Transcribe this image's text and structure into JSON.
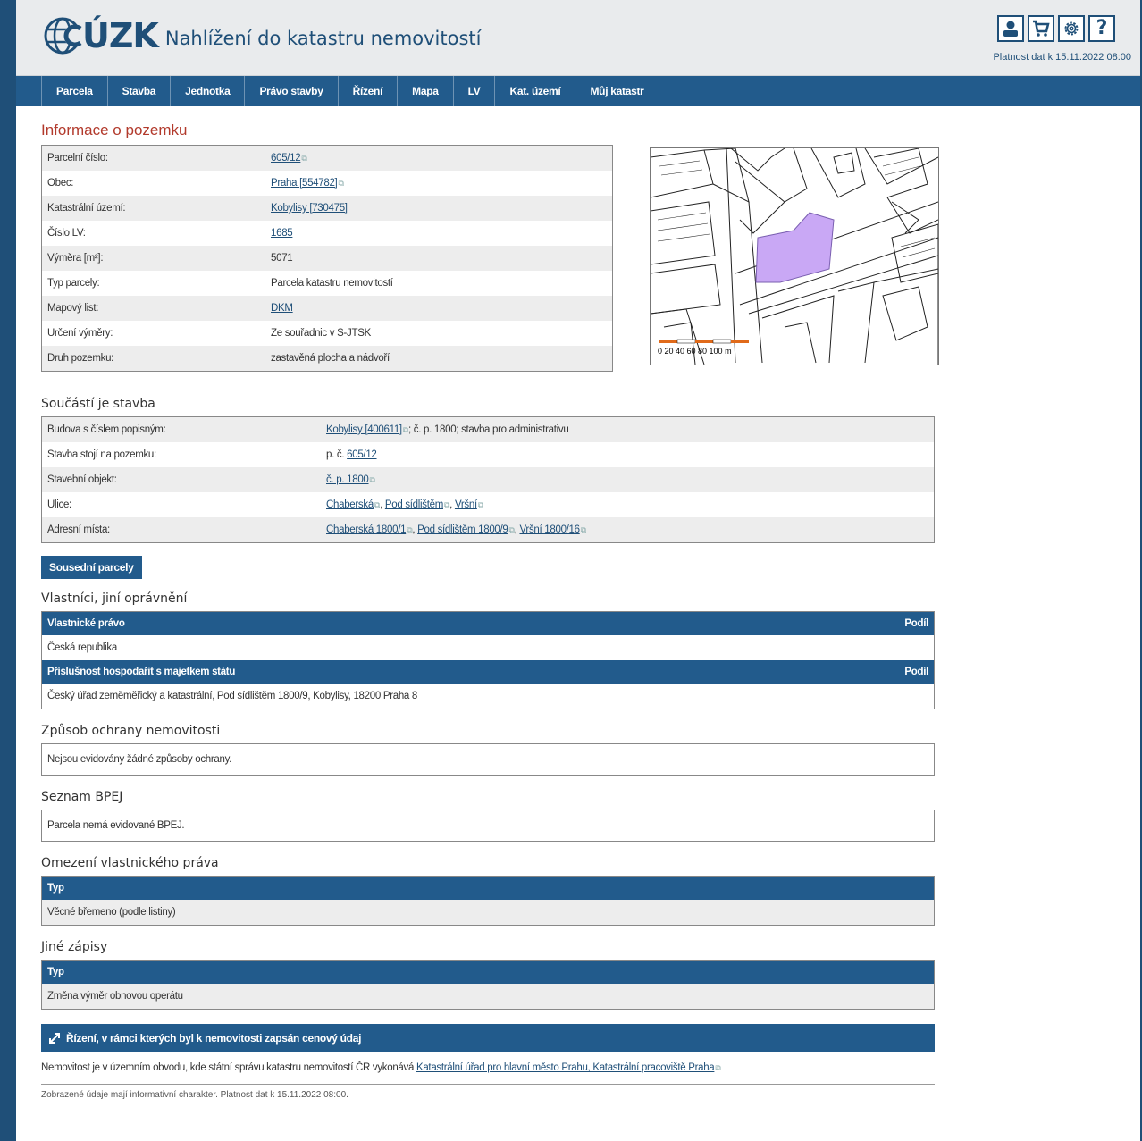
{
  "header": {
    "brand": "ÚZK",
    "app_title": "Nahlížení do katastru nemovitostí",
    "validity": "Platnost dat k 15.11.2022 08:00",
    "tools": [
      "user-icon",
      "cart-icon",
      "gear-icon",
      "help-icon"
    ],
    "help_glyph": "?"
  },
  "nav": [
    "Parcela",
    "Stavba",
    "Jednotka",
    "Právo stavby",
    "Řízení",
    "Mapa",
    "LV",
    "Kat. území",
    "Můj katastr"
  ],
  "land": {
    "title": "Informace o pozemku",
    "rows": [
      {
        "label": "Parcelní číslo:",
        "value": "605/12",
        "link": true,
        "ext": true
      },
      {
        "label": "Obec:",
        "value": "Praha [554782]",
        "link": true,
        "ext": true
      },
      {
        "label": "Katastrální území:",
        "value": "Kobylisy [730475]",
        "link": true,
        "ext": false
      },
      {
        "label": "Číslo LV:",
        "value": "1685",
        "link": true,
        "ext": false
      },
      {
        "label": "Výměra [m²]:",
        "value": "5071",
        "link": false,
        "ext": false
      },
      {
        "label": "Typ parcely:",
        "value": "Parcela katastru nemovitostí",
        "link": false,
        "ext": false
      },
      {
        "label": "Mapový list:",
        "value": "DKM",
        "link": true,
        "ext": false
      },
      {
        "label": "Určení výměry:",
        "value": "Ze souřadnic v S-JTSK",
        "link": false,
        "ext": false
      },
      {
        "label": "Druh pozemku:",
        "value": "zastavěná plocha a nádvoří",
        "link": false,
        "ext": false
      }
    ]
  },
  "map": {
    "scale_label": "0  20  40  60  80 100 m",
    "parcel_color": "#c9a8f5"
  },
  "building": {
    "title": "Součástí je stavba",
    "row1_label": "Budova s číslem popisným:",
    "row1_link": "Kobylisy [400611]",
    "row1_rest": "; č. p. 1800; stavba pro administrativu",
    "row2_label": "Stavba stojí na pozemku:",
    "row2_prefix": "p. č. ",
    "row2_link": "605/12",
    "row3_label": "Stavební objekt:",
    "row3_link": "č. p. 1800",
    "row4_label": "Ulice:",
    "row4_links": [
      "Chaberská",
      "Pod sídlištěm",
      "Vršní"
    ],
    "row5_label": "Adresní místa:",
    "row5_links": [
      "Chaberská 1800/1",
      "Pod sídlištěm 1800/9",
      "Vršní 1800/16"
    ],
    "sep": ", "
  },
  "neighbors_button": "Sousední parcely",
  "owners": {
    "title": "Vlastníci, jiní oprávnění",
    "h1": "Vlastnické právo",
    "share": "Podíl",
    "owner1": "Česká republika",
    "h2": "Příslušnost hospodařit s majetkem státu",
    "owner2": "Český úřad zeměměřický a katastrální, Pod sídlištěm 1800/9, Kobylisy, 18200 Praha 8"
  },
  "protection": {
    "title": "Způsob ochrany nemovitosti",
    "text": "Nejsou evidovány žádné způsoby ochrany."
  },
  "bpej": {
    "title": "Seznam BPEJ",
    "text": "Parcela nemá evidované BPEJ."
  },
  "restrictions": {
    "title": "Omezení vlastnického práva",
    "col": "Typ",
    "value": "Věcné břemeno (podle listiny)"
  },
  "other": {
    "title": "Jiné zápisy",
    "col": "Typ",
    "value": "Změna výměr obnovou operátu"
  },
  "proceedings": {
    "title": "Řízení, v rámci kterých byl k nemovitosti zapsán cenový údaj"
  },
  "office": {
    "prefix": "Nemovitost je v územním obvodu, kde státní správu katastru nemovitostí ČR vykonává ",
    "link": "Katastrální úřad pro hlavní město Prahu, Katastrální pracoviště Praha"
  },
  "footer": "Zobrazené údaje mají informativní charakter. Platnost dat k 15.11.2022 08:00."
}
